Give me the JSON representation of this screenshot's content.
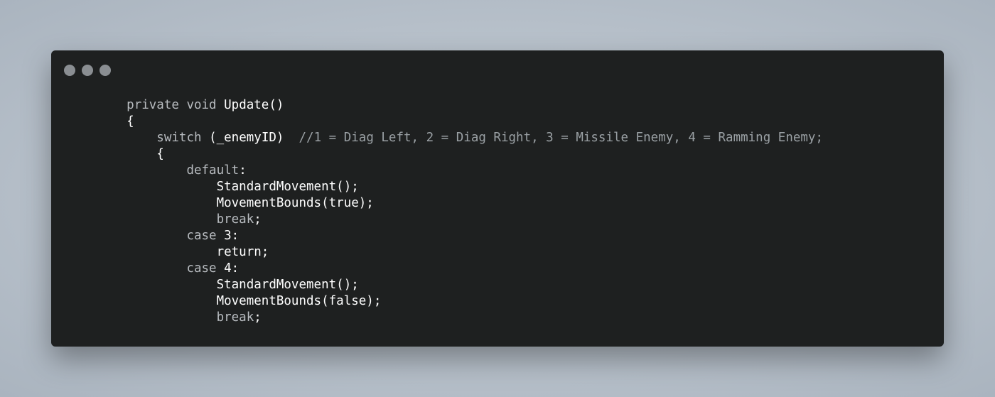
{
  "window": {
    "buttons": [
      "close",
      "minimize",
      "maximize"
    ]
  },
  "code": {
    "lines": [
      {
        "indent": "    ",
        "tokens": [
          {
            "t": "kw",
            "v": "private void "
          },
          {
            "t": "id",
            "v": "Update()"
          }
        ]
      },
      {
        "indent": "    ",
        "tokens": [
          {
            "t": "pl",
            "v": "{"
          }
        ]
      },
      {
        "indent": "        ",
        "tokens": [
          {
            "t": "kw",
            "v": "switch "
          },
          {
            "t": "id",
            "v": "(_enemyID)"
          },
          {
            "t": "cm",
            "v": "  //1 = Diag Left, 2 = Diag Right, 3 = Missile Enemy, 4 = Ramming Enemy;"
          }
        ]
      },
      {
        "indent": "        ",
        "tokens": [
          {
            "t": "pl",
            "v": "{"
          }
        ]
      },
      {
        "indent": "            ",
        "tokens": [
          {
            "t": "kw",
            "v": "default"
          },
          {
            "t": "pl",
            "v": ":"
          }
        ]
      },
      {
        "indent": "                ",
        "tokens": [
          {
            "t": "id",
            "v": "StandardMovement();"
          }
        ]
      },
      {
        "indent": "                ",
        "tokens": [
          {
            "t": "id",
            "v": "MovementBounds(true);"
          }
        ]
      },
      {
        "indent": "                ",
        "tokens": [
          {
            "t": "kw",
            "v": "break"
          },
          {
            "t": "pl",
            "v": ";"
          }
        ]
      },
      {
        "indent": "            ",
        "tokens": [
          {
            "t": "kw",
            "v": "case "
          },
          {
            "t": "id",
            "v": "3:"
          }
        ]
      },
      {
        "indent": "                ",
        "tokens": [
          {
            "t": "id",
            "v": "return;"
          }
        ]
      },
      {
        "indent": "            ",
        "tokens": [
          {
            "t": "kw",
            "v": "case "
          },
          {
            "t": "id",
            "v": "4:"
          }
        ]
      },
      {
        "indent": "                ",
        "tokens": [
          {
            "t": "id",
            "v": "StandardMovement();"
          }
        ]
      },
      {
        "indent": "                ",
        "tokens": [
          {
            "t": "id",
            "v": "MovementBounds(false);"
          }
        ]
      },
      {
        "indent": "                ",
        "tokens": [
          {
            "t": "kw",
            "v": "break"
          },
          {
            "t": "pl",
            "v": ";"
          }
        ]
      }
    ]
  }
}
